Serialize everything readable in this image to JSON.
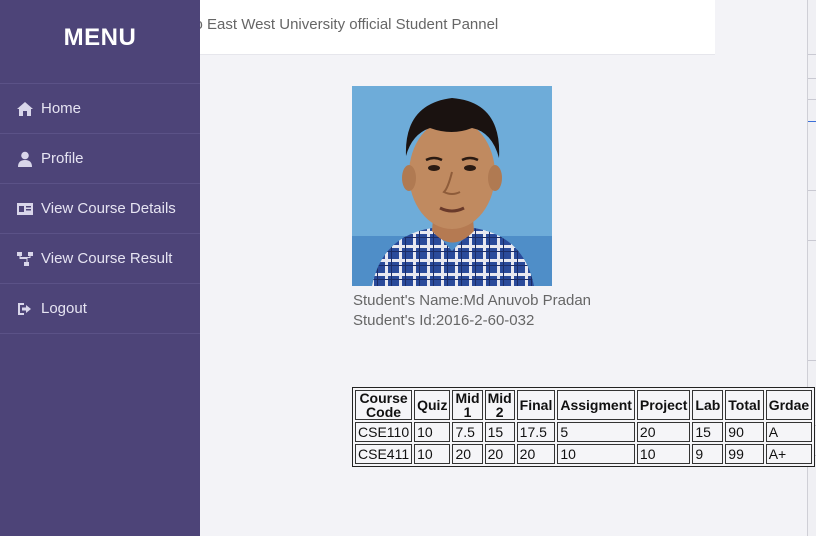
{
  "banner": {
    "text": "To East West University official Student Pannel"
  },
  "sidebar": {
    "title": "MENU",
    "items": [
      {
        "label": "Home",
        "icon": "home-icon"
      },
      {
        "label": "Profile",
        "icon": "user-icon"
      },
      {
        "label": "View Course Details",
        "icon": "id-card-icon"
      },
      {
        "label": "View Course Result",
        "icon": "sitemap-icon"
      },
      {
        "label": "Logout",
        "icon": "sign-out-icon"
      }
    ]
  },
  "student": {
    "name_line": "Student's Name:Md Anuvob Pradan",
    "id_line": "Student's Id:2016-2-60-032"
  },
  "results": {
    "headers": [
      "Course Code",
      "Quiz",
      "Mid 1",
      "Mid 2",
      "Final",
      "Assigment",
      "Project",
      "Lab",
      "Total",
      "Grdae"
    ],
    "rows": [
      [
        "CSE110",
        "10",
        "7.5",
        "15",
        "17.5",
        "5",
        "20",
        "15",
        "90",
        "A"
      ],
      [
        "CSE411",
        "10",
        "20",
        "20",
        "20",
        "10",
        "10",
        "9",
        "99",
        "A+"
      ]
    ]
  },
  "colors": {
    "sidebar": "#4d4478",
    "background": "#f3f3f7"
  }
}
